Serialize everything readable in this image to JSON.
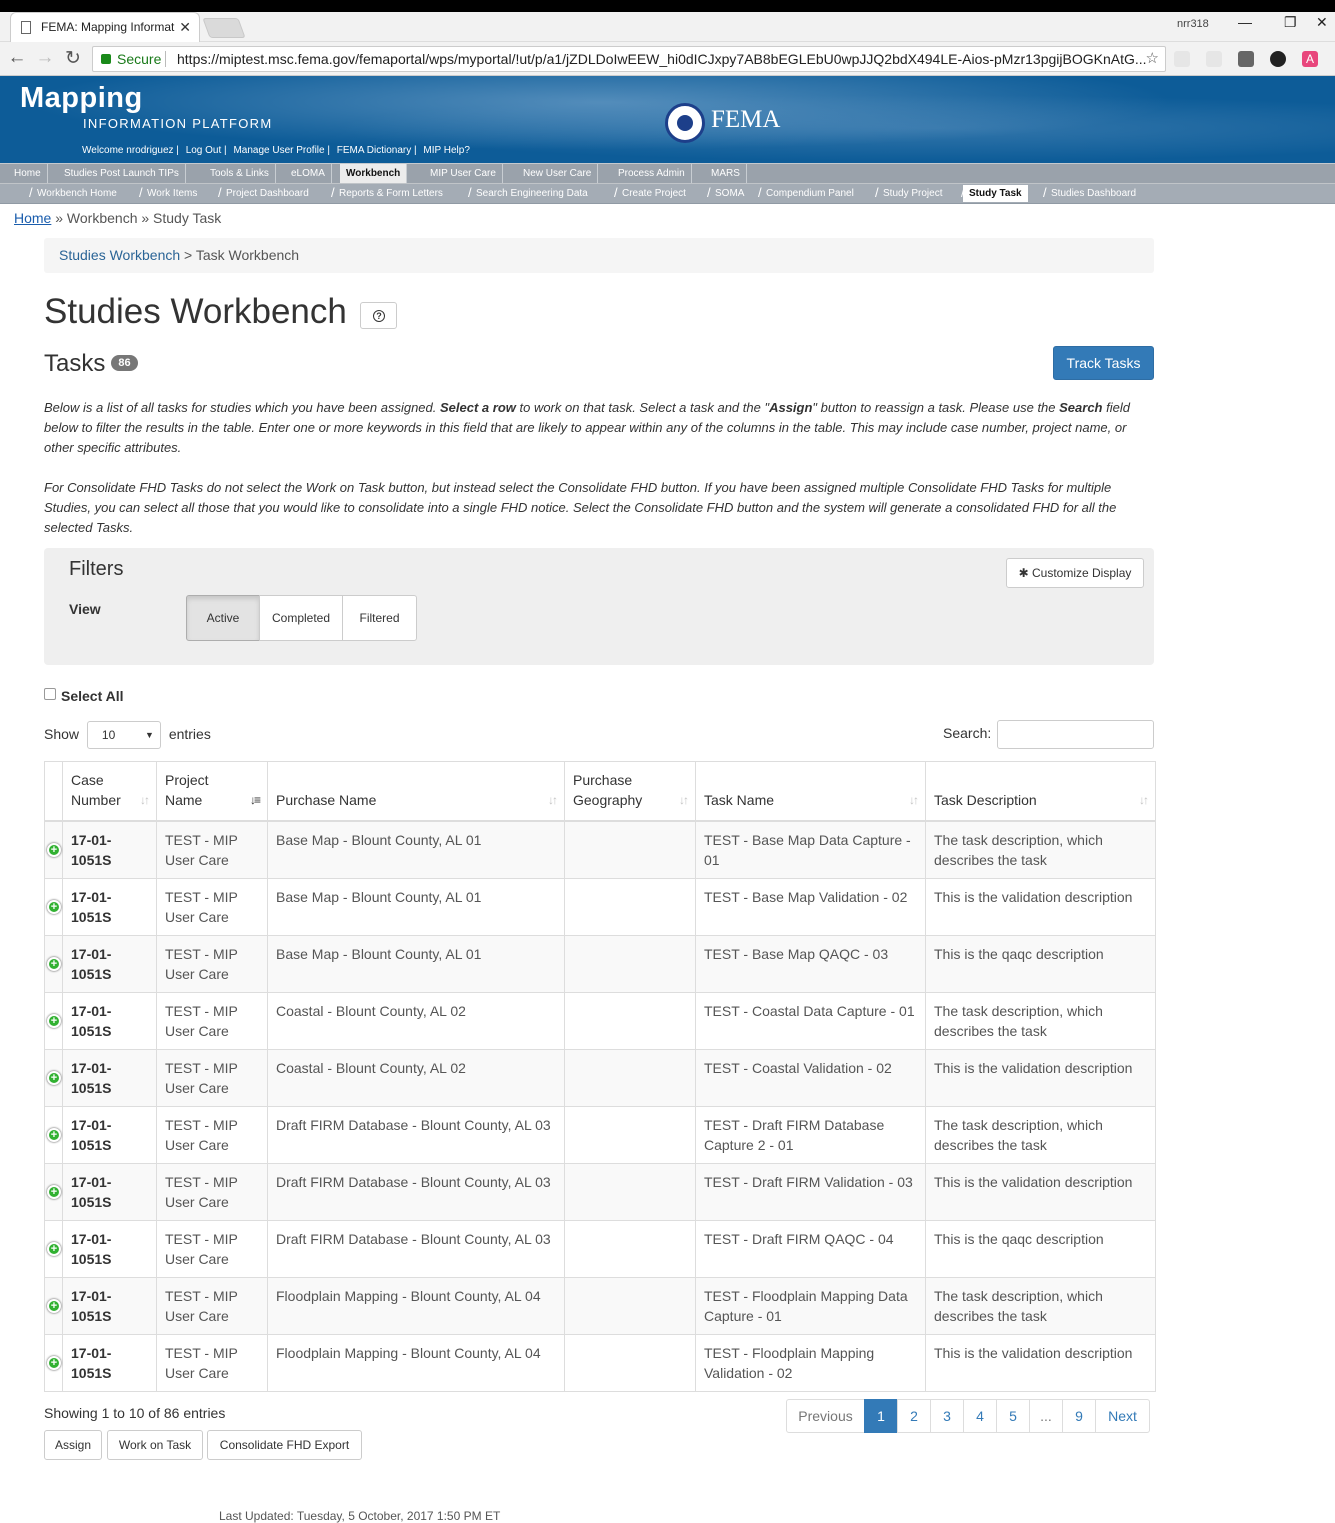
{
  "browser": {
    "tab_title": "FEMA: Mapping Informat",
    "profile": "nrr318",
    "secure_label": "Secure",
    "url": "https://miptest.msc.fema.gov/femaportal/wps/myportal/!ut/p/a1/jZDLDoIwEEW_hi0dICJxpy7AB8bEGLEbU0wpJJQ2bdX494LE-Aios-pMzr13pgijBOGKnAtG..."
  },
  "header": {
    "mapping": "Mapping",
    "platform": "INFORMATION PLATFORM",
    "fema": "FEMA",
    "user_links": [
      "Welcome nrodriguez |",
      "Log Out |",
      "Manage User Profile |",
      "FEMA Dictionary |",
      "MIP Help?"
    ]
  },
  "nav_primary": [
    "Home",
    "Studies Post Launch TIPs",
    "Tools & Links",
    "eLOMA",
    "Workbench",
    "MIP User Care",
    "New User Care",
    "Process Admin",
    "MARS"
  ],
  "nav_primary_active": "Workbench",
  "nav_secondary": [
    "Workbench Home",
    "Work Items",
    "Project Dashboard",
    "Reports & Form Letters",
    "Search Engineering Data",
    "Create Project",
    "SOMA",
    "Compendium Panel",
    "Study Project",
    "Study Task",
    "Studies Dashboard"
  ],
  "nav_secondary_active": "Study Task",
  "breadcrumb": {
    "home": "Home",
    "rest": "» Workbench » Study Task"
  },
  "subcrumb": {
    "link": "Studies Workbench",
    "rest": " > Task Workbench"
  },
  "page_title": "Studies Workbench",
  "tasks_heading": "Tasks",
  "tasks_count": "86",
  "track_button": "Track Tasks",
  "intro": {
    "p1_a": "Below is a list of all tasks for studies which you have been assigned. ",
    "p1_b": "Select a row",
    "p1_c": " to work on that task. Select a task and the \"",
    "p1_d": "Assign",
    "p1_e": "\" button to reassign a task. Please use the ",
    "p1_f": "Search",
    "p1_g": " field below to filter the results in the table. Enter one or more keywords in this field that are likely to appear within any of the columns in the table. This may include case number, project name, or other specific attributes.",
    "p2": "For Consolidate FHD Tasks do not select the Work on Task button, but instead select the Consolidate FHD button. If you have been assigned multiple Consolidate FHD Tasks for multiple Studies, you can select all those that you would like to consolidate into a single FHD notice. Select the Consolidate FHD button and the system will generate a consolidated FHD for all the selected Tasks."
  },
  "filters": {
    "title": "Filters",
    "customize": "Customize Display",
    "view_label": "View",
    "views": [
      "Active",
      "Completed",
      "Filtered"
    ],
    "active_view": "Active"
  },
  "select_all": "Select All",
  "show_label": "Show",
  "show_value": "10",
  "entries_label": "entries",
  "search_label": "Search:",
  "table": {
    "columns": [
      {
        "label": "Case Number"
      },
      {
        "label": "Project Name"
      },
      {
        "label": "Purchase Name"
      },
      {
        "label": "Purchase Geography"
      },
      {
        "label": "Task Name"
      },
      {
        "label": "Task Description"
      }
    ],
    "sorted_column": "Project Name",
    "rows": [
      [
        "17-01-1051S",
        "TEST - MIP User Care",
        "Base Map - Blount County, AL 01",
        "",
        "TEST - Base Map Data Capture - 01",
        "The task description, which describes the task"
      ],
      [
        "17-01-1051S",
        "TEST - MIP User Care",
        "Base Map - Blount County, AL 01",
        "",
        "TEST - Base Map Validation - 02",
        "This is the validation description"
      ],
      [
        "17-01-1051S",
        "TEST - MIP User Care",
        "Base Map - Blount County, AL 01",
        "",
        "TEST - Base Map QAQC - 03",
        "This is the qaqc description"
      ],
      [
        "17-01-1051S",
        "TEST - MIP User Care",
        "Coastal - Blount County, AL 02",
        "",
        "TEST - Coastal Data Capture - 01",
        "The task description, which describes the task"
      ],
      [
        "17-01-1051S",
        "TEST - MIP User Care",
        "Coastal - Blount County, AL 02",
        "",
        "TEST - Coastal Validation - 02",
        "This is the validation description"
      ],
      [
        "17-01-1051S",
        "TEST - MIP User Care",
        "Draft FIRM Database - Blount County, AL 03",
        "",
        "TEST - Draft FIRM Database Capture 2 - 01",
        "The task description, which describes the task"
      ],
      [
        "17-01-1051S",
        "TEST - MIP User Care",
        "Draft FIRM Database - Blount County, AL 03",
        "",
        "TEST - Draft FIRM Validation - 03",
        "This is the validation description"
      ],
      [
        "17-01-1051S",
        "TEST - MIP User Care",
        "Draft FIRM Database - Blount County, AL 03",
        "",
        "TEST - Draft FIRM QAQC - 04",
        "This is the qaqc description"
      ],
      [
        "17-01-1051S",
        "TEST - MIP User Care",
        "Floodplain Mapping - Blount County, AL 04",
        "",
        "TEST - Floodplain Mapping Data Capture - 01",
        "The task description, which describes the task"
      ],
      [
        "17-01-1051S",
        "TEST - MIP User Care",
        "Floodplain Mapping - Blount County, AL 04",
        "",
        "TEST - Floodplain Mapping Validation - 02",
        "This is the validation description"
      ]
    ]
  },
  "info": "Showing 1 to 10 of 86 entries",
  "pagination": [
    "Previous",
    "1",
    "2",
    "3",
    "4",
    "5",
    "...",
    "9",
    "Next"
  ],
  "current_page": "1",
  "actions": [
    "Assign",
    "Work on Task",
    "Consolidate FHD Export"
  ],
  "footer": "Last Updated: Tuesday, 5 October, 2017 1:50 PM ET"
}
